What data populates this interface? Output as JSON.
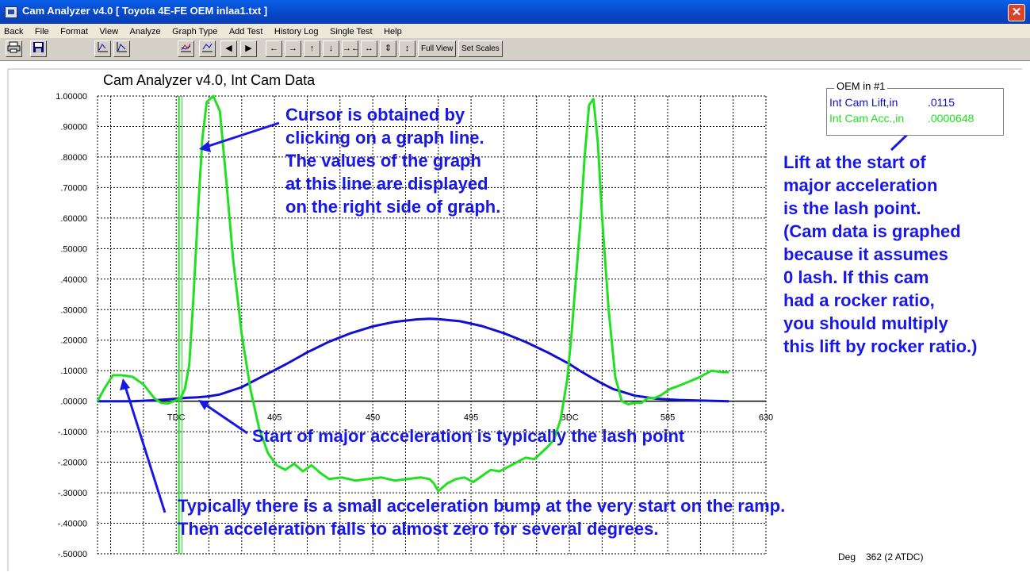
{
  "window": {
    "title": "Cam Analyzer v4.0  [ Toyota 4E-FE OEM inlaa1.txt ]",
    "close_glyph": "✕"
  },
  "menu": [
    "Back",
    "File",
    "Format",
    "View",
    "Analyze",
    "Graph Type",
    "Add Test",
    "History Log",
    "Single Test",
    "Help"
  ],
  "toolbar": {
    "full_view": "Full View",
    "set_scales": "Set Scales",
    "icons": [
      "printer-icon",
      "floppy-save-icon",
      "graph-type-a-icon",
      "graph-type-b-icon",
      "chart-overlay-icon",
      "chart-line-icon",
      "cursor-left-icon",
      "cursor-right-icon",
      "arrow-left-icon",
      "arrow-right-icon",
      "arrow-up-icon",
      "arrow-down-icon",
      "compress-horizontal-icon",
      "expand-horizontal-icon",
      "compress-vertical-icon",
      "expand-vertical-icon"
    ]
  },
  "chart_data": {
    "type": "line",
    "title": "Cam Analyzer v4.0,   Int Cam Data",
    "y_tick_labels": [
      "1.00000",
      ".90000",
      ".80000",
      ".70000",
      ".60000",
      ".50000",
      ".40000",
      ".30000",
      ".20000",
      ".10000",
      ".00000",
      "-.10000",
      "-.20000",
      "-.30000",
      "-.40000",
      "-.50000"
    ],
    "ylim": [
      -0.5,
      1.0
    ],
    "x_tick_labels": [
      "TDC",
      "405",
      "450",
      "495",
      "BDC",
      "585",
      "630"
    ],
    "x_ticks": [
      360,
      405,
      450,
      495,
      540,
      585,
      630
    ],
    "xlim": [
      324,
      630
    ],
    "grid": true,
    "cursor_x": 362,
    "series": [
      {
        "name": "Int Cam Lift,in",
        "color": "#1010d0",
        "x": [
          324,
          340,
          350,
          360,
          365,
          370,
          375,
          380,
          390,
          400,
          410,
          420,
          430,
          440,
          450,
          460,
          470,
          476,
          480,
          490,
          500,
          510,
          520,
          530,
          540,
          545,
          550,
          555,
          560,
          570,
          580,
          590,
          600,
          613
        ],
        "y": [
          0,
          0,
          0.003,
          0.008,
          0.011,
          0.013,
          0.016,
          0.022,
          0.046,
          0.083,
          0.12,
          0.16,
          0.195,
          0.223,
          0.245,
          0.26,
          0.268,
          0.27,
          0.269,
          0.262,
          0.246,
          0.223,
          0.194,
          0.16,
          0.122,
          0.099,
          0.078,
          0.058,
          0.04,
          0.018,
          0.008,
          0.004,
          0.002,
          0
        ]
      },
      {
        "name": "Int Cam Acc.,in",
        "color": "#20e020",
        "x": [
          324,
          327,
          331,
          335,
          340,
          345,
          350,
          353,
          356,
          359,
          362,
          364,
          366,
          368,
          370,
          372,
          374,
          377,
          380,
          383,
          386,
          390,
          394,
          398,
          402,
          406,
          410,
          414,
          418,
          422,
          426,
          430,
          436,
          442,
          448,
          454,
          460,
          466,
          472,
          476,
          478,
          480,
          484,
          488,
          492,
          496,
          500,
          504,
          508,
          512,
          516,
          520,
          524,
          527,
          530,
          533,
          536,
          539,
          541,
          543,
          545,
          547,
          549,
          551,
          553,
          555,
          558,
          561,
          564,
          567,
          570,
          573,
          576,
          579,
          582,
          586,
          590,
          595,
          600,
          605,
          610,
          613
        ],
        "y": [
          0,
          0.04,
          0.085,
          0.085,
          0.08,
          0.055,
          0.01,
          -0.005,
          -0.008,
          0,
          0.01,
          0.04,
          0.12,
          0.35,
          0.62,
          0.86,
          0.98,
          1.0,
          0.95,
          0.72,
          0.47,
          0.22,
          0.04,
          -0.09,
          -0.17,
          -0.21,
          -0.225,
          -0.205,
          -0.23,
          -0.21,
          -0.235,
          -0.255,
          -0.25,
          -0.26,
          -0.255,
          -0.25,
          -0.26,
          -0.255,
          -0.25,
          -0.255,
          -0.27,
          -0.295,
          -0.27,
          -0.255,
          -0.25,
          -0.265,
          -0.245,
          -0.225,
          -0.23,
          -0.215,
          -0.2,
          -0.185,
          -0.19,
          -0.17,
          -0.15,
          -0.125,
          -0.06,
          0.07,
          0.22,
          0.4,
          0.58,
          0.8,
          0.97,
          0.99,
          0.85,
          0.6,
          0.3,
          0.08,
          0.0,
          -0.01,
          -0.005,
          -0.005,
          0.01,
          0.01,
          0.02,
          0.04,
          0.05,
          0.065,
          0.08,
          0.1,
          0.095,
          0.095
        ]
      }
    ]
  },
  "legend": {
    "title": "OEM in #1",
    "rows": [
      {
        "label": "Int Cam Lift,in",
        "value": ".0115",
        "color": "#1010d0"
      },
      {
        "label": "Int Cam Acc.,in",
        "value": ".0000648",
        "color": "#20e020"
      }
    ]
  },
  "status": {
    "deg_label": "Deg",
    "deg_value": "362 (2 ATDC)"
  },
  "annotations": {
    "cursor": [
      "Cursor is obtained by",
      "clicking on a graph line.",
      "The values of the graph",
      "at this line are displayed",
      "on the right side of graph."
    ],
    "lift": [
      "Lift at the start of",
      "major acceleration",
      "is the lash point.",
      "(Cam data is graphed",
      "because it assumes",
      "0 lash.  If this cam",
      "had a rocker ratio,",
      "you should multiply",
      "this lift by rocker ratio.)"
    ],
    "start": "Start of major acceleration is typically the lash point",
    "bump": [
      "Typically there is a small acceleration bump at the very start on the ramp.",
      "Then acceleration falls to almost zero for  several degrees."
    ]
  }
}
